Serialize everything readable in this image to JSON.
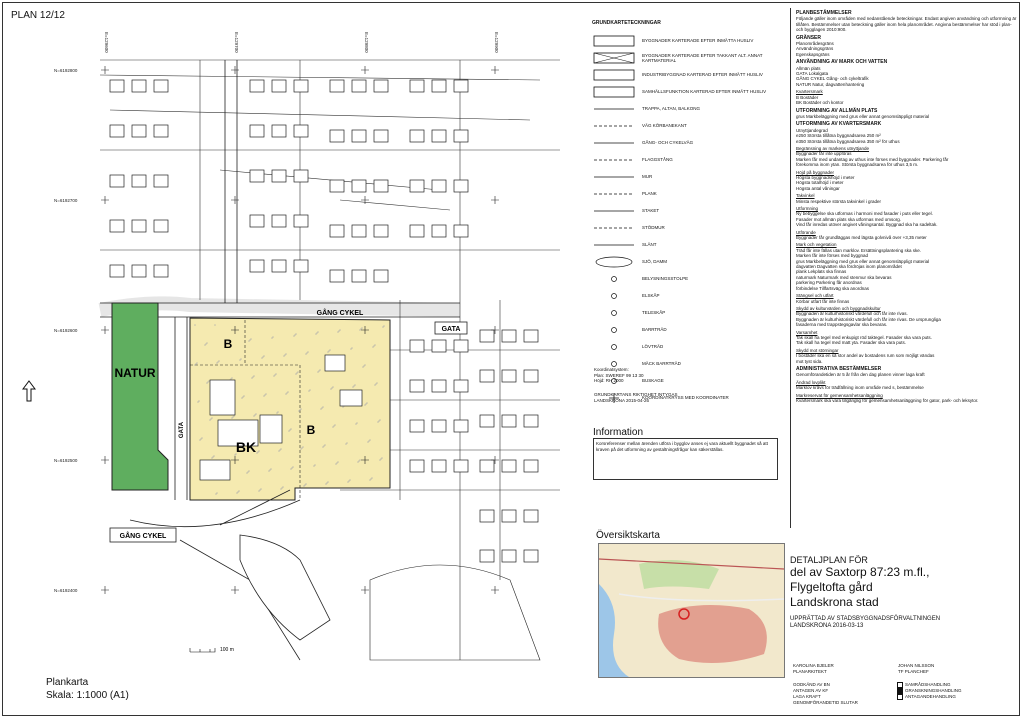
{
  "sheet": {
    "plan_no": "PLAN 12/12",
    "plankarta": "Plankarta",
    "skala": "Skala: 1:1000 (A1)"
  },
  "map": {
    "labels": {
      "natur": "NATUR",
      "bk": "BK",
      "b1": "B",
      "b2": "B",
      "gata": "GATA",
      "gang_cykel_top": "GÅNG CYKEL",
      "gang_cykel_left": "GÅNG CYKEL",
      "gata_vertical": "GATA"
    },
    "northings": [
      "N=6192800",
      "N=6192700",
      "N=6192600",
      "N=6192500",
      "N=6192400"
    ],
    "eastings": [
      "E=129600",
      "E=129700",
      "E=129800",
      "E=129900"
    ],
    "scale_label": "100 m",
    "colors": {
      "natur": "#5fae5f",
      "bk": "#f5eab0",
      "outline": "#222"
    }
  },
  "legend": {
    "heading": "GRUNDKARTETECKNINGAR",
    "items": [
      "BYGGNADER KARTERADE EFTER INMÄTTA HUSLIV",
      "BYGGNADER KARTERADE EFTER TAKKANT ALT. ANNAT KARTMATERIAL",
      "INDUSTRIBYGGNAD KARTERAD EFTER INMÄTT HUSLIV",
      "SAMHÄLLSFUNKTION KARTERAD EFTER INMÄTT HUSLIV",
      "TRAPPA, ALTAN, BALKONG",
      "VÄG KÖRBANEKANT",
      "GÅNG- OCH CYKELVÄG",
      "FLAGGSTÅNG",
      "MUR",
      "PLANK",
      "STAKET",
      "STÖDMUR",
      "SLÄNT",
      "SJÖ, DAMM",
      "BELYSNINGSSTOLPE",
      "ELSKÅP",
      "TELESKÅP",
      "BARRTRÄD",
      "LÖVTRÄD",
      "MÄCK BARRTRÄD",
      "BUSKAGE",
      "KOORDINATKRYSS MED KOORDINATER"
    ],
    "koord": [
      "Koordinatsystem:",
      "Plan: SWEREF 99 13 30",
      "Höjd: RH 2000"
    ],
    "grundkarta": [
      "GRUNDKARTANS RIKTIGHET INTYGAS",
      "LANDSKRONA 2015-04-26"
    ]
  },
  "information": {
    "title": "Information",
    "text": "Korsreferenser mellan ärenden utföra i bygglov anses ej vara aktuellt byggnadet så att kraven på det utformning av gestaltningsfrågor kan säkerställas."
  },
  "oversikt": {
    "title": "Översiktskarta",
    "colors": {
      "land": "#f2e8cc",
      "urban": "#e2a090",
      "water": "#9dc6e8",
      "green": "#c7dfa8",
      "marker": "#d62020"
    }
  },
  "bestammelser": {
    "heading": "PLANBESTÄMMELSER",
    "intro": "Följande gäller inom områden med nedanstående beteckningar. Endast angiven användning och utformning är tillåten. Bestämmelser utan beteckning gäller inom hela planområdet. Angivna bestämmelser har stöd i plan- och bygglagen 2010:900.",
    "sections": [
      {
        "h": "GRÄNSER",
        "lines": [
          "Planområdesgräns",
          "Användningsgräns",
          "Egenskapsgräns"
        ]
      },
      {
        "h": "ANVÄNDNING AV MARK OCH VATTEN",
        "lines": [
          "Allmän plats",
          "GATA Lokalgata",
          "GÅNG CYKEL Gång- och cykeltrafik",
          "NATUR Natur, dagvattenhantering"
        ]
      },
      {
        "h": "Kvartersmark",
        "lines": [
          "B Bostäder",
          "BK Bostäder och kontor"
        ]
      },
      {
        "h": "UTFORMNING AV ALLMÄN PLATS",
        "lines": [
          "grus Markbeläggning med grus eller annat genomsläppligt material"
        ]
      },
      {
        "h": "UTFORMNING AV KVARTERSMARK",
        "lines": [
          "Utnyttjandegrad",
          "e250 Största tillåtna byggnadsarea 250 m²",
          "e350 Största tillåtna byggnadsarea 350 m² för uthus"
        ]
      },
      {
        "h": "Begränsning av markens utnyttjande",
        "lines": [
          "Byggnader får inte uppföras",
          "Marken får med undantag av uthus inte förses med byggnader. Parkering får",
          "förekomma inom ytan. Största byggnadsarea för uthus 3,5 m."
        ]
      },
      {
        "h": "Höjd på byggnader",
        "lines": [
          "Högsta byggnadshöjd i meter",
          "Högsta totalhöjd i meter",
          "Högsta antal våningar"
        ]
      },
      {
        "h": "Takvinkel",
        "lines": [
          "Minsta respektive största takvinkel i grader"
        ]
      },
      {
        "h": "Utformning",
        "lines": [
          "Ny bebyggelse ska utformas i harmoni med fasader i puts eller tegel.",
          "Fasader mot allmän plats ska utformas med omsorg.",
          "Vind får inredas utöver angivet våningsantal. Byggnad ska ha sadeltak."
        ]
      },
      {
        "h": "Utförande",
        "lines": [
          "Byggnader får grundläggas med lägsta golvnivå över +3,35 meter"
        ]
      },
      {
        "h": "Mark och vegetation",
        "lines": [
          "Träd får inte fällas utan marklov. Ersättningsplantering ska ske.",
          "Marken får inte förses med byggnad",
          "grus Markbeläggning med grus eller annat genomsläppligt material",
          "dagvatten Dagvatten ska fördröjas inom planområdet",
          "plank Lekplats ska finnas",
          "naturmark Naturmark med stenmur ska bevaras",
          "parkering Parkering får anordnas",
          "förbindelse Tillfartsväg ska anordnas"
        ]
      },
      {
        "h": "Stängsel och utfart",
        "lines": [
          "Körbar utfart får inte finnas"
        ]
      },
      {
        "h": "Skydd av kulturvärden och byggnadskultur",
        "lines": [
          "Byggnaden är kulturhistoriskt värdefull och får inte rivas.",
          "Byggnaden är kulturhistoriskt värdefull och får inte rivas. De ursprungliga",
          "fasaderna med trappstegsgavlar ska bevaras."
        ]
      },
      {
        "h": "Varsamhet",
        "lines": [
          "Tak skall ha tegel med enkupigt röd taktegel. Fasader ska vara puts.",
          "Tak skall ha tegel med matt yta. Fasader ska vara puts."
        ]
      },
      {
        "h": "Skydd mot störningar",
        "lines": [
          "I bostäder ska en så stor andel av bostadens rum som möjligt vändas",
          "mot tyst sida."
        ]
      },
      {
        "h": "ADMINISTRATIVA BESTÄMMELSER",
        "lines": [
          "Genomförandetiden är 5 år från den dag planen vinner laga kraft"
        ]
      },
      {
        "h": "Ändrad lovplikt",
        "lines": [
          "Marklov krävs för trädfällning inom område med s, bestämmelse"
        ]
      },
      {
        "h": "Markreservat för gemensamhetsanläggning",
        "lines": [
          "Kvartersmark ska vara tillgänglig för gemensamhetsanläggning för gator, park- och leksytor."
        ]
      }
    ]
  },
  "title_block": {
    "detaljplan": "DETALJPLAN FÖR",
    "line1": "del av Saxtorp 87:23 m.fl.,",
    "line2": "Flygeltofta gård",
    "line3": "Landskrona stad",
    "upprattad": "UPPRÄTTAD AV STADSBYGGNADSFÖRVALTNINGEN",
    "date": "LANDSKRONA 2016-03-13"
  },
  "signatures": {
    "left_name": "KAROLINA BJELER",
    "left_role": "PLANARKITEKT",
    "right_name": "JOHAN NILSSON",
    "right_role": "TF PLANCHEF"
  },
  "stages": {
    "left": [
      "GODKÄND AV BN",
      "ANTAGEN AV KF",
      "LAGA KRAFT",
      "GENOMFÖRANDETID SLUTAR"
    ],
    "right": [
      {
        "label": "SAMRÅDSHANDLING",
        "checked": false
      },
      {
        "label": "GRANSKNINGSHANDLING",
        "checked": true
      },
      {
        "label": "ANTAGANDEHANDLING",
        "checked": false
      }
    ]
  }
}
